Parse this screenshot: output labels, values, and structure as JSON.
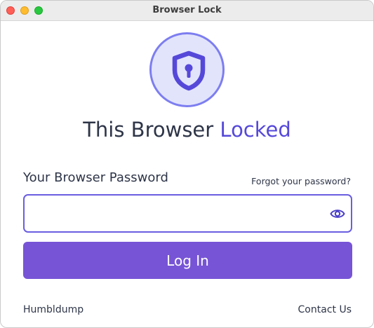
{
  "window": {
    "title": "Browser Lock",
    "controls": [
      "close",
      "minimize",
      "maximize"
    ]
  },
  "lock_badge": {
    "icon": "shield-keyhole-icon",
    "colors": {
      "fill": "#e2e4fc",
      "ring": "#7d7ef0",
      "icon": "#5548d9"
    }
  },
  "heading": {
    "text": "This Browser",
    "accent": "Locked"
  },
  "password": {
    "label": "Your Browser Password",
    "forgot_link": "Forgot your password?",
    "value": "",
    "reveal_icon": "eye-icon"
  },
  "login_button": {
    "label": "Log In",
    "color": "#7754d6"
  },
  "footer": {
    "brand": "Humbldump",
    "contact_link": "Contact Us"
  }
}
